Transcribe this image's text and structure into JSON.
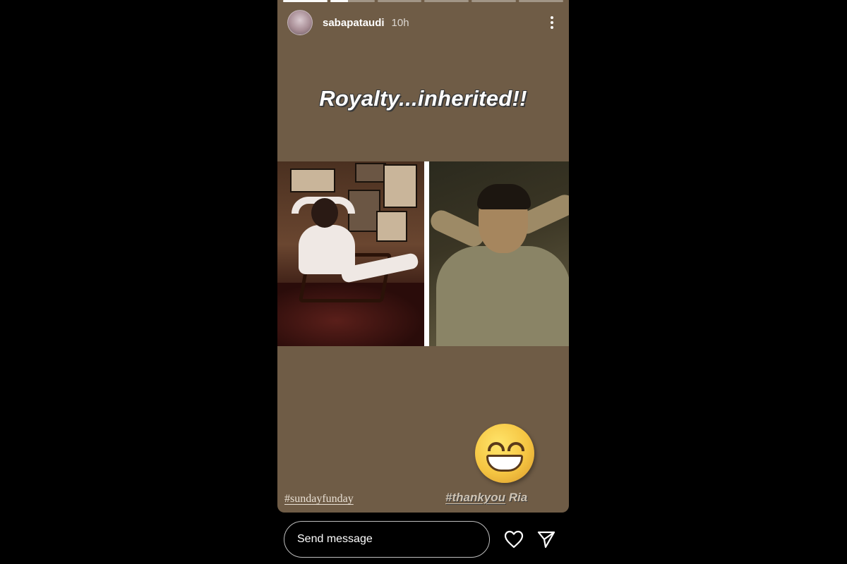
{
  "progress": {
    "segment_count": 6,
    "fill": [
      1,
      0.4,
      0,
      0,
      0,
      0
    ]
  },
  "header": {
    "username": "sabapataudi",
    "time": "10h"
  },
  "story": {
    "headline": "Royalty...inherited!!",
    "hashtag_left": "#sundayfunday",
    "hashtag_right_tag": "#thankyou",
    "hashtag_right_name": " Ria"
  },
  "icons": {
    "avatar": "avatar",
    "more": "more-vertical-icon",
    "heart": "heart-icon",
    "send": "send-icon",
    "emoji": "grinning-face-emoji"
  },
  "reply": {
    "placeholder": "Send message"
  },
  "colors": {
    "story_bg": "#6f5c46",
    "page_bg": "#000000"
  }
}
